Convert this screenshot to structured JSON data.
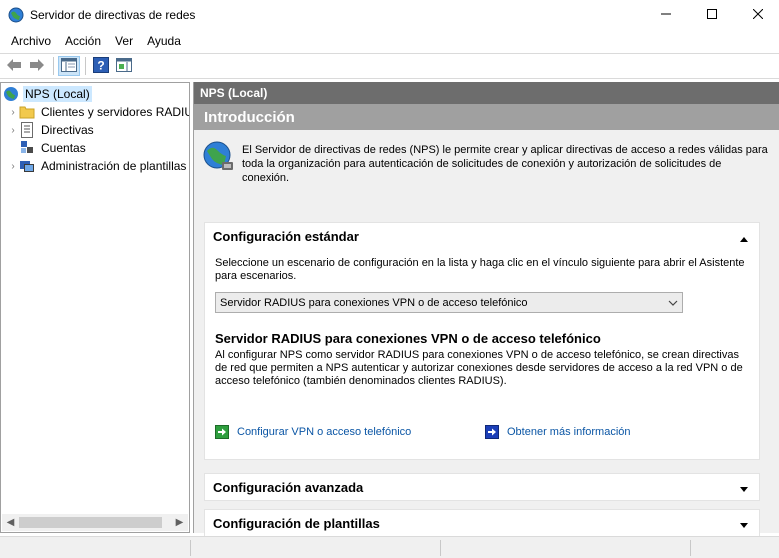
{
  "window": {
    "title": "Servidor de directivas de redes",
    "controls": {
      "minimize": "minimize-icon",
      "maximize": "maximize-icon",
      "close": "close-icon"
    }
  },
  "menu": [
    "Archivo",
    "Acción",
    "Ver",
    "Ayuda"
  ],
  "toolbar": [
    "back-arrow-icon",
    "forward-arrow-icon",
    "show-console-tree-icon",
    "help-icon",
    "action-pane-icon"
  ],
  "tree": {
    "root": "NPS (Local)",
    "items": [
      {
        "label": "Clientes y servidores RADIUS",
        "icon": "folder-icon",
        "expandable": true
      },
      {
        "label": "Directivas",
        "icon": "policy-document-icon",
        "expandable": true
      },
      {
        "label": "Cuentas",
        "icon": "accounting-icon",
        "expandable": false
      },
      {
        "label": "Administración de plantillas",
        "icon": "templates-icon",
        "expandable": true
      }
    ]
  },
  "main": {
    "header": "NPS (Local)",
    "intro_title": "Introducción",
    "intro_text": "El Servidor de directivas de redes (NPS) le permite crear y aplicar directivas de acceso a redes válidas para toda la organización para autenticación de solicitudes de conexión y autorización de solicitudes de conexión.",
    "standard": {
      "title": "Configuración estándar",
      "description": "Seleccione un escenario de configuración en la lista y haga clic en el vínculo siguiente para abrir el Asistente para escenarios.",
      "selected_option": "Servidor RADIUS para conexiones VPN o de acceso telefónico",
      "scenario_title": "Servidor RADIUS para conexiones VPN o de acceso telefónico",
      "scenario_description": "Al configurar NPS como servidor RADIUS para conexiones VPN o de acceso telefónico, se crean directivas de red que permiten a NPS autenticar y autorizar conexiones desde servidores de acceso a la red VPN o de acceso telefónico (también denominados clientes RADIUS).",
      "configure_link": "Configurar VPN o acceso telefónico",
      "more_info_link": "Obtener más información"
    },
    "advanced": {
      "title": "Configuración avanzada"
    },
    "templates": {
      "title": "Configuración de plantillas"
    }
  },
  "colors": {
    "header_bg": "#6d6d6d",
    "intro_band_bg": "#a0a0a0",
    "link": "#0b56a5",
    "selection": "#cce8ff"
  }
}
